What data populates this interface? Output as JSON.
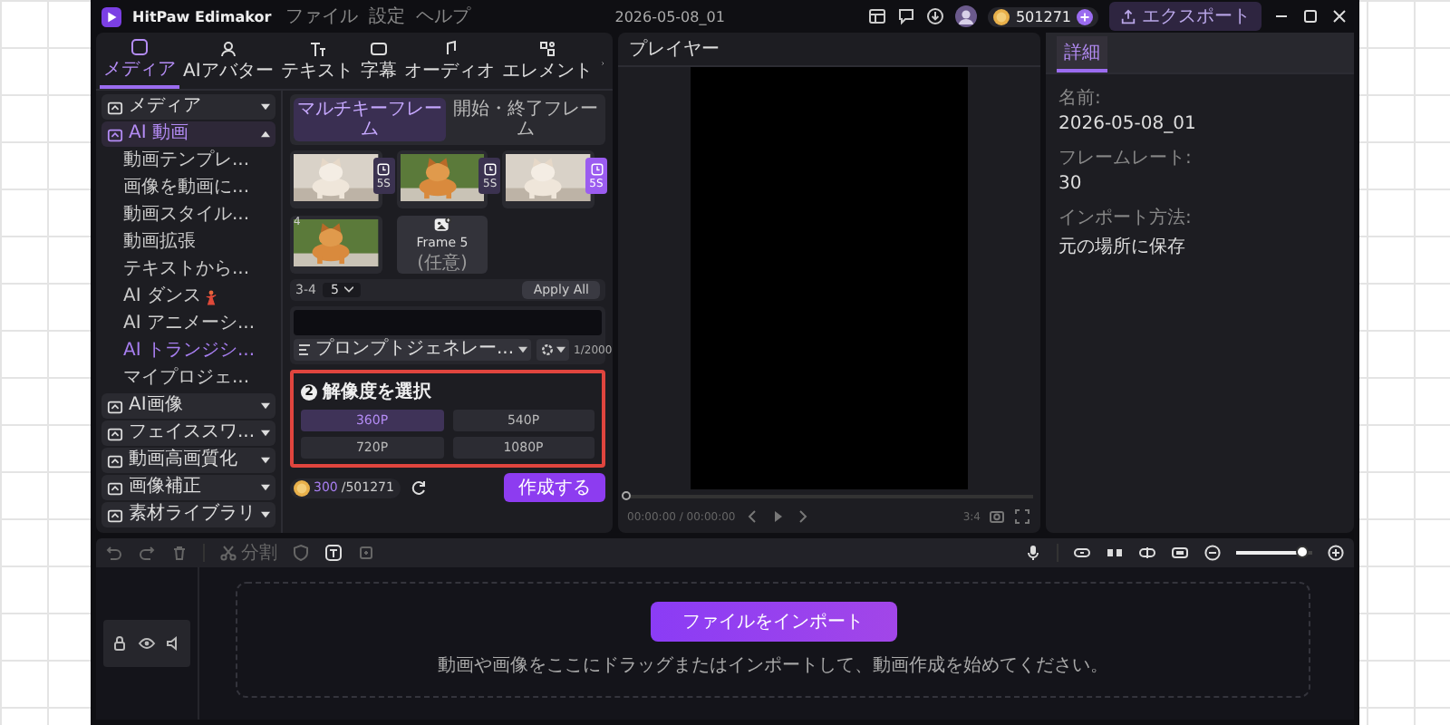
{
  "window": {
    "app_name": "HitPaw Edimakor",
    "menus": [
      "ファイル",
      "設定",
      "ヘルプ"
    ],
    "project_title": "2026-05-08_01",
    "credits": "501271",
    "export_button": "エクスポート"
  },
  "toolbar_tabs": [
    {
      "label": "メディア",
      "selected": true
    },
    {
      "label": "AIアバター",
      "selected": false
    },
    {
      "label": "テキスト",
      "selected": false
    },
    {
      "label": "字幕",
      "selected": false
    },
    {
      "label": "オーディオ",
      "selected": false
    },
    {
      "label": "エレメント",
      "selected": false
    }
  ],
  "sidebar": {
    "items": [
      {
        "label": "メディア",
        "selected": false,
        "expanded": false
      },
      {
        "label": "AI 動画",
        "selected": true,
        "expanded": true,
        "children": [
          {
            "label": "動画テンプレ...",
            "selected": false,
            "hot": false
          },
          {
            "label": "画像を動画に...",
            "selected": false,
            "hot": false
          },
          {
            "label": "動画スタイル...",
            "selected": false,
            "hot": false
          },
          {
            "label": "動画拡張",
            "selected": false,
            "hot": false
          },
          {
            "label": "テキストから...",
            "selected": false,
            "hot": false
          },
          {
            "label": "AI ダンス",
            "selected": false,
            "hot": true
          },
          {
            "label": "AI アニメーシ...",
            "selected": false,
            "hot": false
          },
          {
            "label": "AI トランジシ...",
            "selected": true,
            "hot": false
          },
          {
            "label": "マイプロジェ...",
            "selected": false,
            "hot": false
          }
        ]
      },
      {
        "label": "AI画像",
        "selected": false,
        "expanded": false
      },
      {
        "label": "フェイススワ...",
        "selected": false,
        "expanded": false
      },
      {
        "label": "動画高画質化",
        "selected": false,
        "expanded": false
      },
      {
        "label": "画像補正",
        "selected": false,
        "expanded": false
      },
      {
        "label": "素材ライブラリ",
        "selected": false,
        "expanded": false
      }
    ]
  },
  "generator": {
    "tabs": [
      {
        "label": "マルチキーフレーム",
        "selected": true
      },
      {
        "label": "開始・終了フレーム",
        "selected": false
      }
    ],
    "frames": [
      {
        "kind": "picture",
        "duration": "5S",
        "selected": false
      },
      {
        "kind": "picture",
        "duration": "5S",
        "selected": false
      },
      {
        "kind": "picture",
        "duration": "5S",
        "selected": true
      },
      {
        "kind": "picture",
        "number": "4"
      },
      {
        "kind": "add",
        "label": "Frame 5",
        "note": "(任意)"
      }
    ],
    "segment": {
      "range": "3-4",
      "duration": "5",
      "apply_button": "Apply All"
    },
    "prompt": {
      "generator": "プロンプトジェネレー...",
      "counter": "1/2000"
    },
    "resolution": {
      "step": "2",
      "title": "解像度を選択",
      "options": [
        {
          "label": "360P",
          "selected": true
        },
        {
          "label": "540P",
          "selected": false
        },
        {
          "label": "720P",
          "selected": false
        },
        {
          "label": "1080P",
          "selected": false
        }
      ]
    },
    "cost": {
      "used": "300",
      "total": "/501271"
    },
    "create_button": "作成する"
  },
  "player": {
    "title": "プレイヤー",
    "time": "00:00:00 / 00:00:00",
    "aspect": "3:4"
  },
  "details": {
    "tabs": [
      {
        "label": "詳細",
        "selected": true
      }
    ],
    "fields": [
      {
        "label": "名前:",
        "value": "2026-05-08_01"
      },
      {
        "label": "フレームレート:",
        "value": "30"
      },
      {
        "label": "インポート方法:",
        "value": "元の場所に保存"
      }
    ]
  },
  "timeline": {
    "split_label": "分割",
    "zoom": {
      "level": 0.85
    },
    "import_button": "ファイルをインポート",
    "hint": "動画や画像をここにドラッグまたはインポートして、動画作成を始めてください。"
  }
}
